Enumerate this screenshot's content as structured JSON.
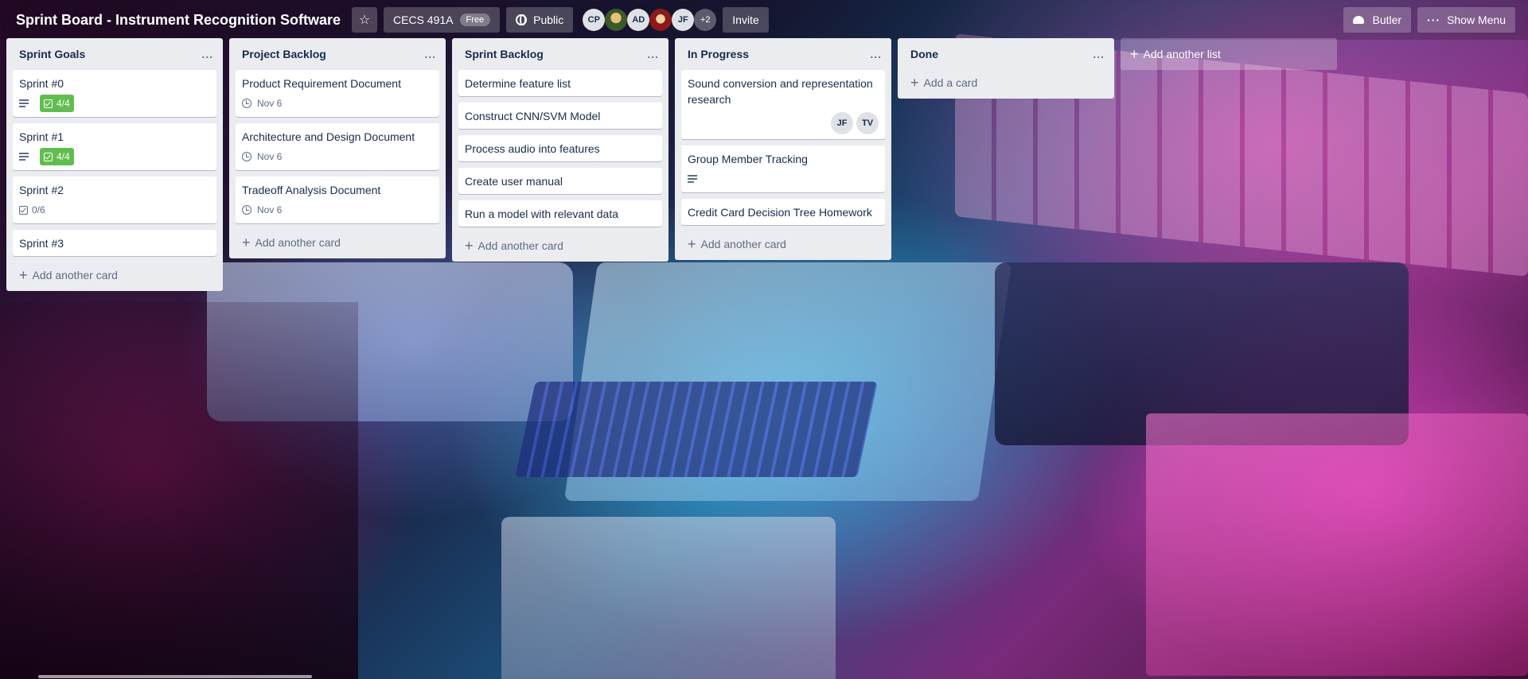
{
  "header": {
    "board_title": "Sprint Board - Instrument Recognition Software",
    "team_name": "CECS 491A",
    "team_badge": "Free",
    "visibility": "Public",
    "members": [
      "CP",
      "AD",
      "JF"
    ],
    "members_more": "+2",
    "invite_label": "Invite",
    "butler_label": "Butler",
    "show_menu_label": "Show Menu",
    "icons": [
      "star-icon",
      "globe-icon",
      "butler-icon",
      "more-icon"
    ]
  },
  "lists": [
    {
      "title": "Sprint Goals",
      "menu": "...",
      "add_label": "Add another card",
      "cards": [
        {
          "title": "Sprint #0",
          "checklist": "4/4"
        },
        {
          "title": "Sprint #1",
          "checklist": "4/4"
        },
        {
          "title": "Sprint #2",
          "checklist": "0/6"
        },
        {
          "title": "Sprint #3"
        }
      ]
    },
    {
      "title": "Project Backlog",
      "menu": "...",
      "add_label": "Add another card",
      "cards": [
        {
          "title": "Product Requirement Document",
          "due": "Nov 6"
        },
        {
          "title": "Architecture and Design Document",
          "due": "Nov 6"
        },
        {
          "title": "Tradeoff Analysis Document",
          "due": "Nov 6"
        }
      ]
    },
    {
      "title": "Sprint Backlog",
      "menu": "...",
      "add_label": "Add another card",
      "cards": [
        {
          "title": "Determine feature list"
        },
        {
          "title": "Construct CNN/SVM Model"
        },
        {
          "title": "Process audio into features"
        },
        {
          "title": "Create user manual"
        },
        {
          "title": "Run a model with relevant data"
        }
      ]
    },
    {
      "title": "In Progress",
      "menu": "...",
      "add_label": "Add another card",
      "cards": [
        {
          "title": "Sound conversion and representation research",
          "members": [
            "JF",
            "TV"
          ]
        },
        {
          "title": "Group Member Tracking"
        },
        {
          "title": "Credit Card Decision Tree Homework"
        }
      ]
    },
    {
      "title": "Done",
      "menu": "...",
      "add_label": "Add a card",
      "cards": []
    }
  ],
  "add_list_label": "Add another list",
  "colors": {
    "checklist_complete": "#61bd4f",
    "list_background": "#ebecf0",
    "card_text": "#172b4d"
  }
}
